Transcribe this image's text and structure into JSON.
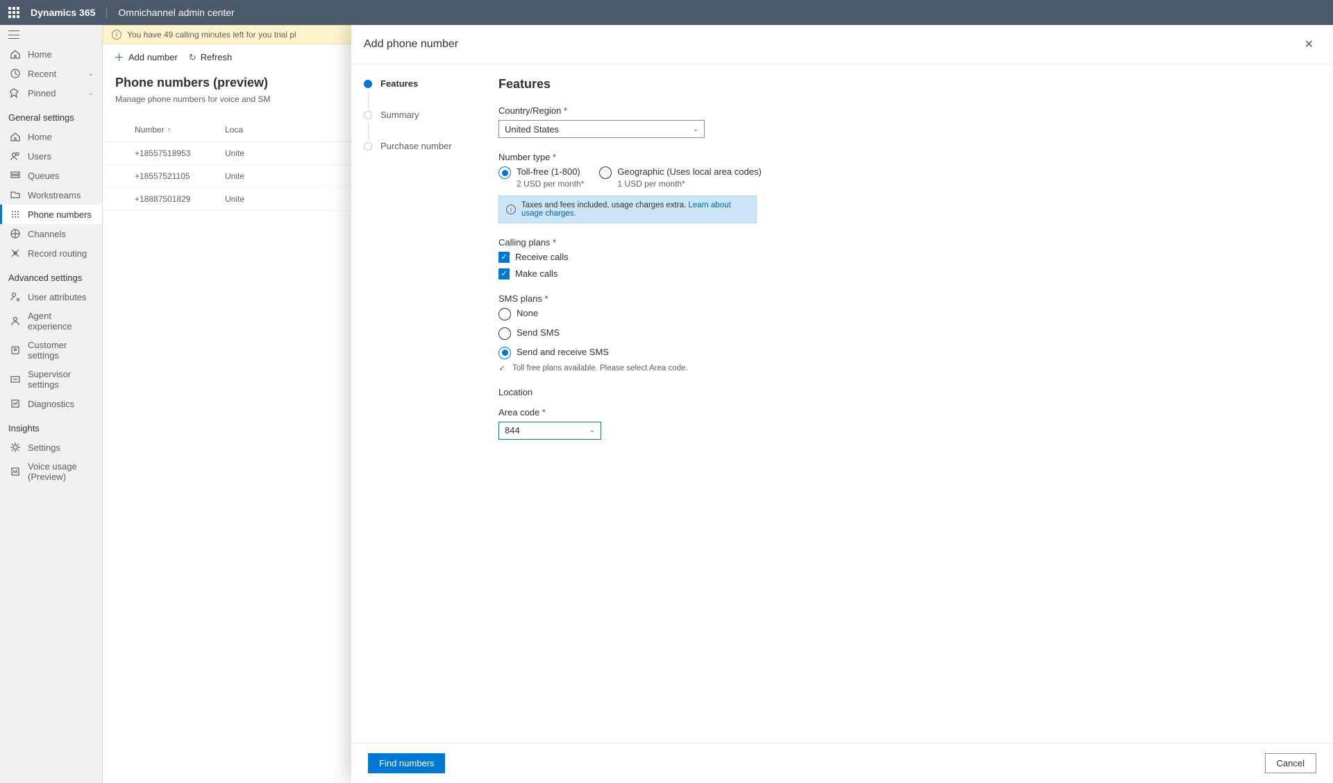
{
  "topbar": {
    "brand": "Dynamics 365",
    "app": "Omnichannel admin center"
  },
  "sidebar": {
    "top": [
      {
        "label": "Home",
        "icon": "home"
      },
      {
        "label": "Recent",
        "icon": "clock",
        "chevron": true
      },
      {
        "label": "Pinned",
        "icon": "pin",
        "chevron": true
      }
    ],
    "general_header": "General settings",
    "general": [
      {
        "label": "Home",
        "icon": "home"
      },
      {
        "label": "Users",
        "icon": "users"
      },
      {
        "label": "Queues",
        "icon": "queues"
      },
      {
        "label": "Workstreams",
        "icon": "workstreams"
      },
      {
        "label": "Phone numbers",
        "icon": "phone",
        "active": true
      },
      {
        "label": "Channels",
        "icon": "channels"
      },
      {
        "label": "Record routing",
        "icon": "routing"
      }
    ],
    "advanced_header": "Advanced settings",
    "advanced": [
      {
        "label": "User attributes",
        "icon": "userattr"
      },
      {
        "label": "Agent experience",
        "icon": "agent"
      },
      {
        "label": "Customer settings",
        "icon": "customer"
      },
      {
        "label": "Supervisor settings",
        "icon": "supervisor"
      },
      {
        "label": "Diagnostics",
        "icon": "diagnostics"
      }
    ],
    "insights_header": "Insights",
    "insights": [
      {
        "label": "Settings",
        "icon": "gear"
      },
      {
        "label": "Voice usage (Preview)",
        "icon": "voice"
      }
    ]
  },
  "banner": "You have 49 calling minutes left for you trial pl",
  "cmdbar": {
    "add": "Add number",
    "refresh": "Refresh"
  },
  "page": {
    "title": "Phone numbers (preview)",
    "subtitle": "Manage phone numbers for voice and SM",
    "col_number": "Number",
    "col_location": "Loca",
    "rows": [
      {
        "number": "+18557518953",
        "loc": "Unite"
      },
      {
        "number": "+18557521105",
        "loc": "Unite"
      },
      {
        "number": "+18887501829",
        "loc": "Unite"
      }
    ]
  },
  "flyout": {
    "title": "Add phone number",
    "steps": [
      {
        "label": "Features",
        "active": true
      },
      {
        "label": "Summary"
      },
      {
        "label": "Purchase number"
      }
    ],
    "form": {
      "heading": "Features",
      "country_label": "Country/Region",
      "country_value": "United States",
      "numtype_label": "Number type",
      "numtype_opts": [
        {
          "label": "Toll-free (1-800)",
          "sub": "2 USD per month*",
          "checked": true
        },
        {
          "label": "Geographic (Uses local area codes)",
          "sub": "1 USD per month*"
        }
      ],
      "tax_note": "Taxes and fees included, usage charges extra.",
      "tax_link": "Learn about usage charges.",
      "calling_label": "Calling plans",
      "calling_opts": [
        {
          "label": "Receive calls",
          "checked": true
        },
        {
          "label": "Make calls",
          "checked": true
        }
      ],
      "sms_label": "SMS plans",
      "sms_opts": [
        {
          "label": "None"
        },
        {
          "label": "Send SMS"
        },
        {
          "label": "Send and receive SMS",
          "checked": true
        }
      ],
      "plan_note": "Toll free plans available. Please select Area code.",
      "location_head": "Location",
      "area_label": "Area code",
      "area_value": "844",
      "find_btn": "Find numbers",
      "cancel_btn": "Cancel"
    }
  }
}
